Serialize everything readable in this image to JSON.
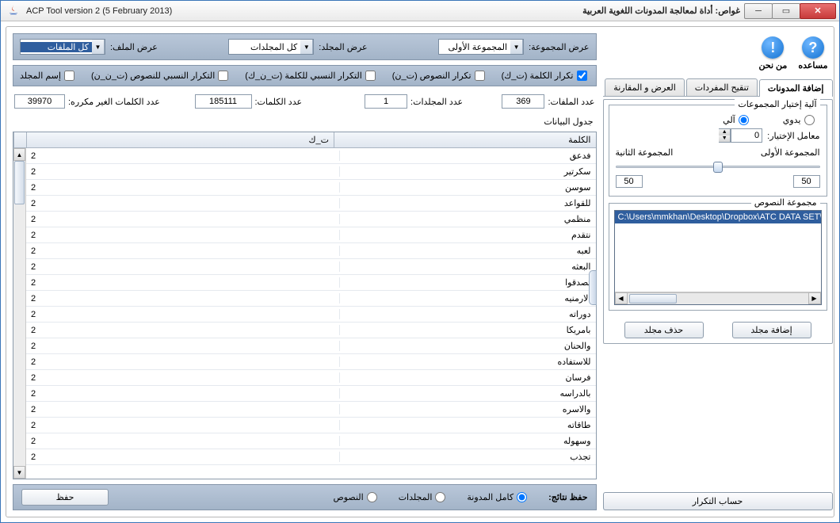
{
  "window": {
    "title_left": "ACP Tool version 2 (5 February 2013)",
    "title_right": "غواص: أداة لمعالجة المدونات اللغوية العربية"
  },
  "help": {
    "help_label": "مساعده",
    "about_label": "من نحن",
    "help_glyph": "?",
    "about_glyph": "!"
  },
  "tabs": {
    "add": "إضافة المدونات",
    "refine": "تنقيح المفردات",
    "compare": "العرض و المقارنة"
  },
  "group_mode": {
    "box_title": "آلية إختيار المجموعات",
    "manual": "يدوي",
    "auto": "آلي",
    "factor_label": "معامل الإختيار:",
    "factor_value": "0",
    "slider_left": "المجموعة الأولى",
    "slider_right": "المجموعة الثانية",
    "val_left": "50",
    "val_right": "50"
  },
  "text_group": {
    "box_title": "مجموعة النصوص",
    "item": "C:\\Users\\mmkhan\\Desktop\\Dropbox\\ATC DATA SET\\N"
  },
  "btns": {
    "add_folder": "إضافة مجلد",
    "del_folder": "حذف مجلد",
    "compute": "حساب التكرار",
    "save": "حفظ"
  },
  "topstrip": {
    "l_group": "عرض المجموعة:",
    "v_group": "المجموعة الأولى",
    "l_folder": "عرض المجلد:",
    "v_folder": "كل المجلدات",
    "l_file": "عرض الملف:",
    "v_file": "كل الملفات"
  },
  "checks": {
    "c1": "تكرار الكلمة (ت_ك)",
    "c2": "تكرار النصوص (ت_ن)",
    "c3": "التكرار النسبي للكلمة (ت_ن_ك)",
    "c4": "التكرار النسبي للنصوص (ت_ن_ن)",
    "c5": "إسم المجلد"
  },
  "stats": {
    "l_files": "عدد الملفات:",
    "v_files": "369",
    "l_folders": "عدد المجلدات:",
    "v_folders": "1",
    "l_words": "عدد الكلمات:",
    "v_words": "185111",
    "l_unique": "عدد الكلمات الغير مكرره:",
    "v_unique": "39970"
  },
  "table": {
    "title": "جدول البيانات",
    "h_word": "الكلمة",
    "h_tk": "ت_ك",
    "rows": [
      {
        "w": "فدعق",
        "v": "2"
      },
      {
        "w": "سكرتير",
        "v": "2"
      },
      {
        "w": "سوسن",
        "v": "2"
      },
      {
        "w": "للقواعد",
        "v": "2"
      },
      {
        "w": "منظمي",
        "v": "2"
      },
      {
        "w": "نتقدم",
        "v": "2"
      },
      {
        "w": "لعبه",
        "v": "2"
      },
      {
        "w": "البعثه",
        "v": "2"
      },
      {
        "w": "تصدقوا",
        "v": "2"
      },
      {
        "w": "الارمنيه",
        "v": "2"
      },
      {
        "w": "دوراته",
        "v": "2"
      },
      {
        "w": "بامريكا",
        "v": "2"
      },
      {
        "w": "والحنان",
        "v": "2"
      },
      {
        "w": "للاستفاده",
        "v": "2"
      },
      {
        "w": "فرسان",
        "v": "2"
      },
      {
        "w": "بالدراسه",
        "v": "2"
      },
      {
        "w": "والاسره",
        "v": "2"
      },
      {
        "w": "طاقاته",
        "v": "2"
      },
      {
        "w": "وسهوله",
        "v": "2"
      },
      {
        "w": "تجذب",
        "v": "2"
      }
    ]
  },
  "save_strip": {
    "label": "حفظ نتائج:",
    "r_full": "كامل المدونة",
    "r_folders": "المجلدات",
    "r_texts": "النصوص"
  }
}
